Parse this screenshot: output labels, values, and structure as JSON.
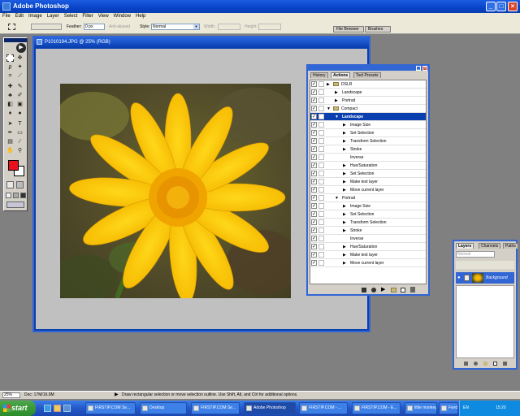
{
  "window": {
    "title": "Adobe Photoshop"
  },
  "menu": [
    "File",
    "Edit",
    "Image",
    "Layer",
    "Select",
    "Filter",
    "View",
    "Window",
    "Help"
  ],
  "options": {
    "feather_label": "Feather:",
    "feather_value": "0 px",
    "antialias_label": "Anti-aliased",
    "style_label": "Style:",
    "style_value": "Normal",
    "width_label": "Width:",
    "height_label": "Height:",
    "tabs": [
      "File Browser",
      "Brushes"
    ]
  },
  "document": {
    "title": "P1010194.JPG @ 25% (RGB)"
  },
  "actions_panel": {
    "tabs": [
      "History",
      "Actions",
      "Tool Presets"
    ],
    "rows": [
      {
        "level": 0,
        "label": "DSLR",
        "type": "set"
      },
      {
        "level": 1,
        "label": "Landscape",
        "type": "action"
      },
      {
        "level": 1,
        "label": "Portrait",
        "type": "action"
      },
      {
        "level": 0,
        "label": "Compact",
        "type": "set",
        "open": true
      },
      {
        "level": 1,
        "label": "Landscape",
        "type": "action",
        "open": true,
        "selected": true
      },
      {
        "level": 2,
        "label": "Image Size",
        "type": "step"
      },
      {
        "level": 2,
        "label": "Set Selection",
        "type": "step"
      },
      {
        "level": 2,
        "label": "Transform Selection",
        "type": "step"
      },
      {
        "level": 2,
        "label": "Stroke",
        "type": "step"
      },
      {
        "level": 2,
        "label": "Inverse",
        "type": "plain"
      },
      {
        "level": 2,
        "label": "Hue/Saturation",
        "type": "step"
      },
      {
        "level": 2,
        "label": "Set Selection",
        "type": "step"
      },
      {
        "level": 2,
        "label": "Make text layer",
        "type": "step"
      },
      {
        "level": 2,
        "label": "Move current layer",
        "type": "step"
      },
      {
        "level": 1,
        "label": "Portrait",
        "type": "action",
        "open": true
      },
      {
        "level": 2,
        "label": "Image Size",
        "type": "step"
      },
      {
        "level": 2,
        "label": "Set Selection",
        "type": "step"
      },
      {
        "level": 2,
        "label": "Transform Selection",
        "type": "step"
      },
      {
        "level": 2,
        "label": "Stroke",
        "type": "step"
      },
      {
        "level": 2,
        "label": "Inverse",
        "type": "plain"
      },
      {
        "level": 2,
        "label": "Hue/Saturation",
        "type": "step"
      },
      {
        "level": 2,
        "label": "Make text layer",
        "type": "step"
      },
      {
        "level": 2,
        "label": "Move current layer",
        "type": "step"
      }
    ]
  },
  "layers_panel": {
    "tabs": [
      "Layers",
      "Channels",
      "Paths"
    ],
    "blend_mode": "Normal",
    "layer_name": "Background"
  },
  "status": {
    "zoom": "25%",
    "doc_size": "Doc: 17M/16.9M",
    "hint": "Draw rectangular selection or move selection outline. Use Shift, Alt, and Ctrl for additional options."
  },
  "taskbar": {
    "start_label": "start",
    "items": [
      "FIRSTIP.COM Se...",
      "Desktop",
      "FIRSTIP.COM Se...",
      "Adobe Photoshop",
      "FIRSTIP.COM - ...",
      "FIRSTIP.COM - E...",
      "little monkey - ...",
      "Fwrdp - ACDSee..."
    ],
    "active_index": 3,
    "lang": "EN",
    "clock": "15:20"
  },
  "colors": {
    "foreground": "#e8101c",
    "background": "#ffffff",
    "xp_blue": "#0a3fb0"
  }
}
